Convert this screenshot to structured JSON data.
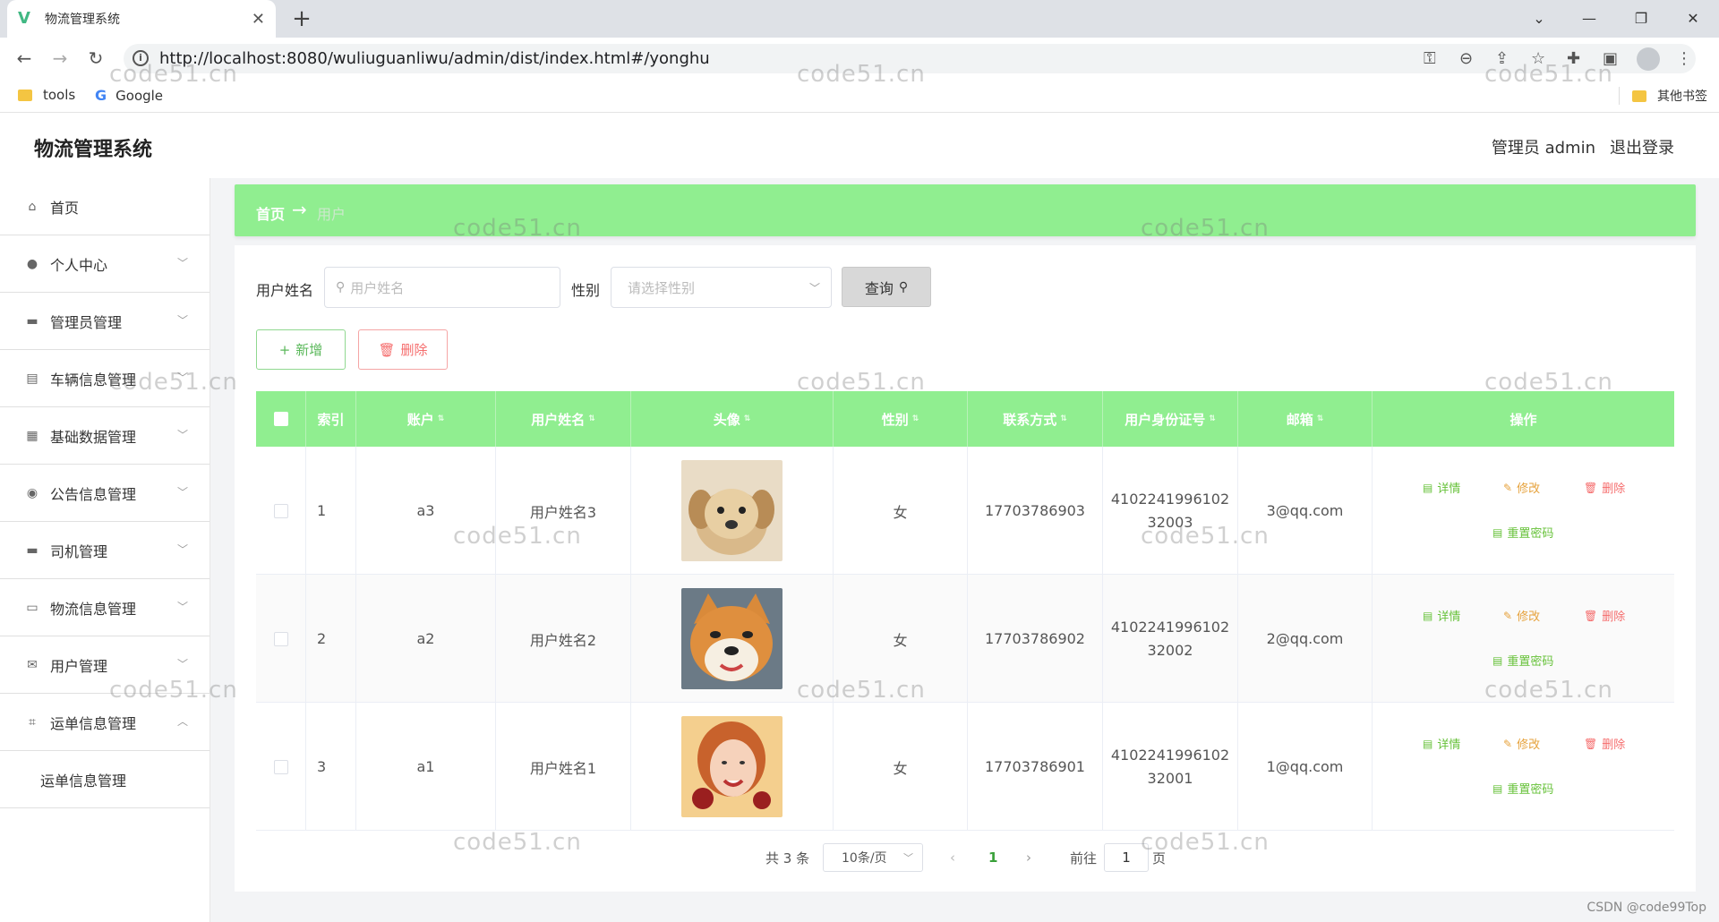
{
  "browser": {
    "tab_title": "物流管理系统",
    "url": "http://localhost:8080/wuliuguanliwu/admin/dist/index.html#/yonghu",
    "bookmarks": [
      "tools",
      "Google"
    ],
    "other_bookmarks": "其他书签"
  },
  "app": {
    "title": "物流管理系统",
    "admin_label": "管理员 admin",
    "logout_label": "退出登录"
  },
  "sidebar": {
    "items": [
      {
        "label": "首页",
        "icon": "home-icon"
      },
      {
        "label": "个人中心",
        "icon": "user-icon"
      },
      {
        "label": "管理员管理",
        "icon": "chat-icon"
      },
      {
        "label": "车辆信息管理",
        "icon": "clipboard-icon"
      },
      {
        "label": "基础数据管理",
        "icon": "grid-icon"
      },
      {
        "label": "公告信息管理",
        "icon": "bulb-icon"
      },
      {
        "label": "司机管理",
        "icon": "folder-icon"
      },
      {
        "label": "物流信息管理",
        "icon": "message-icon"
      },
      {
        "label": "用户管理",
        "icon": "mail-icon"
      },
      {
        "label": "运单信息管理",
        "icon": "crop-icon"
      }
    ],
    "sub_item": "运单信息管理"
  },
  "breadcrumb": {
    "home": "首页",
    "current": "用户"
  },
  "search": {
    "name_label": "用户姓名",
    "name_placeholder": "用户姓名",
    "gender_label": "性别",
    "gender_placeholder": "请选择性别",
    "query_label": "查询"
  },
  "actions": {
    "add": "新增",
    "delete": "删除"
  },
  "table": {
    "headers": [
      "索引",
      "账户",
      "用户姓名",
      "头像",
      "性别",
      "联系方式",
      "用户身份证号",
      "邮箱",
      "操作"
    ],
    "rows": [
      {
        "index": "1",
        "account": "a3",
        "name": "用户姓名3",
        "gender": "女",
        "phone": "17703786903",
        "id_line1": "4102241996102",
        "id_line2": "32003",
        "email": "3@qq.com",
        "avatar": "puppy-photo"
      },
      {
        "index": "2",
        "account": "a2",
        "name": "用户姓名2",
        "gender": "女",
        "phone": "17703786902",
        "id_line1": "4102241996102",
        "id_line2": "32002",
        "email": "2@qq.com",
        "avatar": "shiba-photo"
      },
      {
        "index": "3",
        "account": "a1",
        "name": "用户姓名1",
        "gender": "女",
        "phone": "17703786901",
        "id_line1": "4102241996102",
        "id_line2": "32001",
        "email": "1@qq.com",
        "avatar": "woman-photo"
      }
    ],
    "row_actions": {
      "detail": "详情",
      "edit": "修改",
      "delete": "删除",
      "reset": "重置密码"
    }
  },
  "pagination": {
    "total": "共 3 条",
    "page_size": "10条/页",
    "current_page": "1",
    "goto_label": "前往",
    "goto_value": "1",
    "page_suffix": "页"
  },
  "watermark": "code51.cn",
  "footer_credit": "CSDN @code99Top",
  "colors": {
    "accent": "#90ee90",
    "detail": "#67c23a",
    "edit": "#e6a23c",
    "delete": "#f56c6c"
  }
}
